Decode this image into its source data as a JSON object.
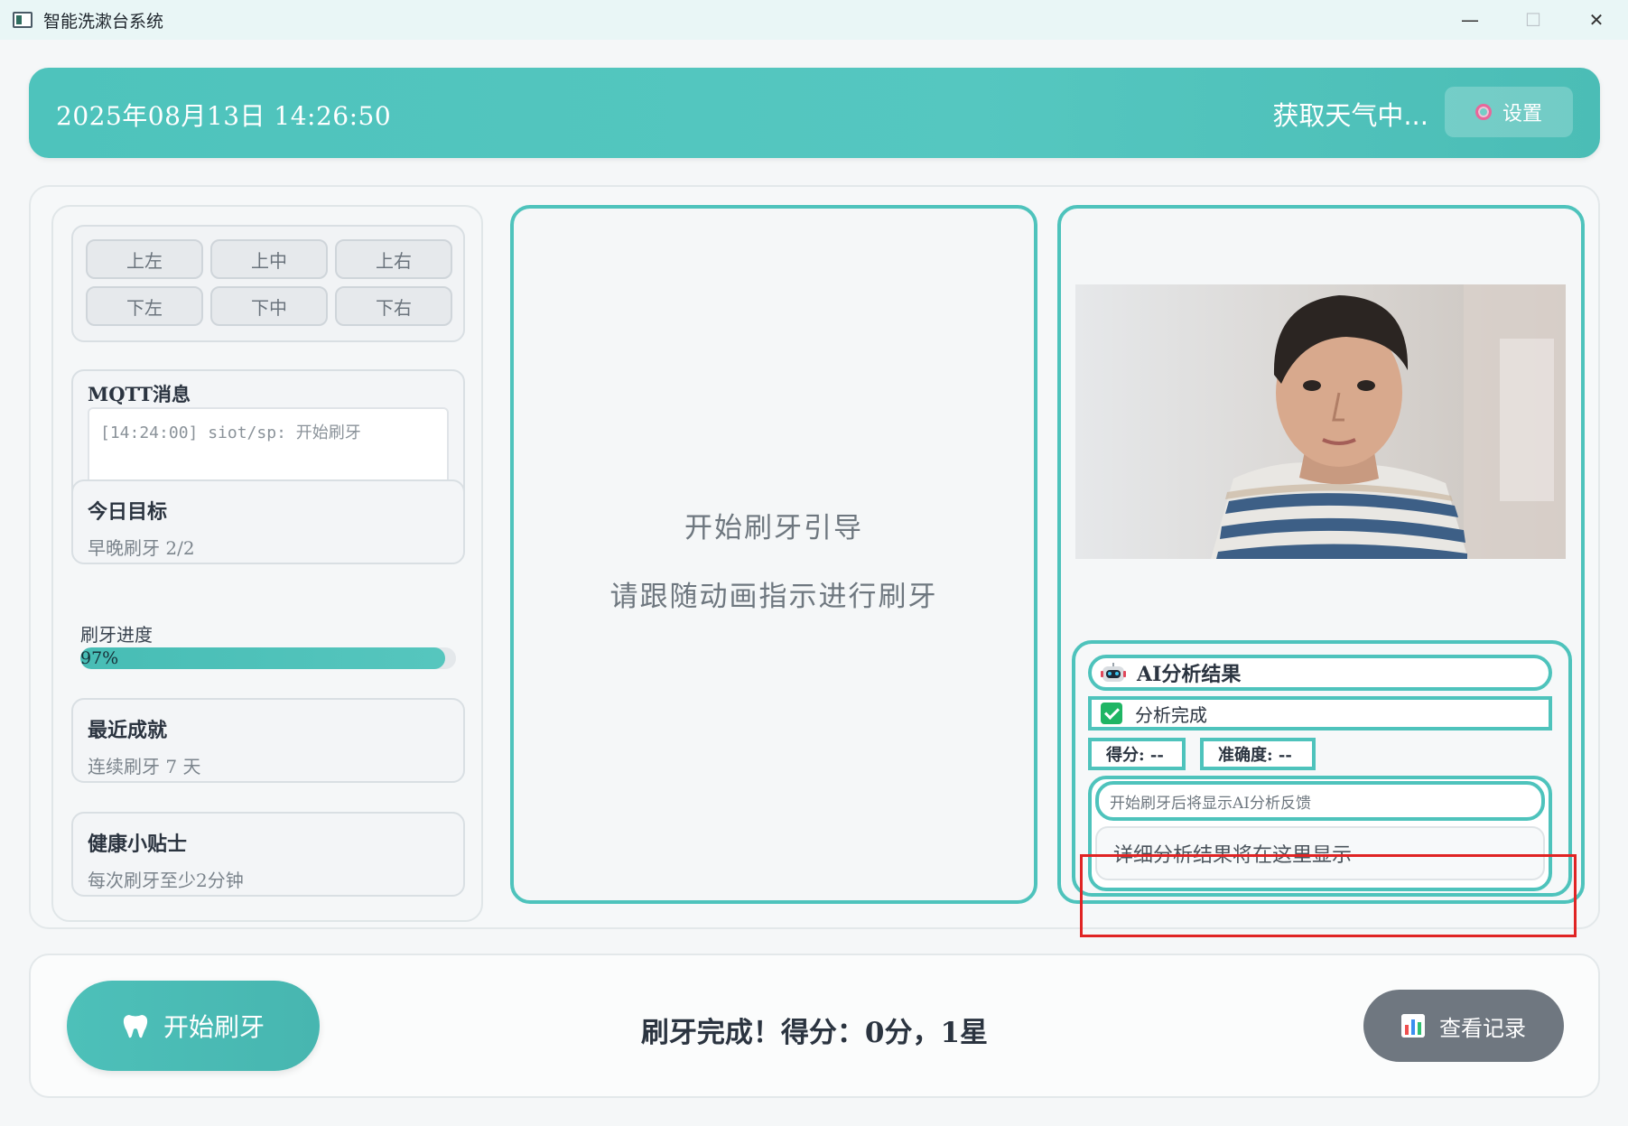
{
  "window": {
    "title": "智能洗漱台系统",
    "minimize": "—",
    "maximize": "☐",
    "close": "✕"
  },
  "header": {
    "datetime": "2025年08月13日 14:26:50",
    "weather": "获取天气中...",
    "settings_label": "设置",
    "settings_icon": "gear-icon"
  },
  "directions": {
    "top_left": "上左",
    "top_mid": "上中",
    "top_right": "上右",
    "bottom_left": "下左",
    "bottom_mid": "下中",
    "bottom_right": "下右"
  },
  "mqtt": {
    "title": "MQTT消息",
    "log": "[14:24:00] siot/sp: 开始刷牙"
  },
  "goal": {
    "title": "今日目标",
    "text": "早晚刷牙 2/2"
  },
  "progress": {
    "label": "刷牙进度",
    "value": 0.97,
    "text": "97%"
  },
  "achievement": {
    "title": "最近成就",
    "text": "连续刷牙 7 天"
  },
  "tip": {
    "title": "健康小贴士",
    "text": "每次刷牙至少2分钟"
  },
  "guide": {
    "title": "开始刷牙引导",
    "subtitle": "请跟随动画指示进行刷牙"
  },
  "ai": {
    "header": "AI分析结果",
    "header_icon": "robot-icon",
    "status": "分析完成",
    "status_icon": "check-icon",
    "score": "得分: --",
    "accuracy": "准确度: --",
    "feedback": "开始刷牙后将显示AI分析反馈",
    "detail": "详细分析结果将在这里显示"
  },
  "bottom": {
    "start_label": "开始刷牙",
    "start_icon": "tooth-icon",
    "result": "刷牙完成！得分：0分，1星",
    "records_label": "查看记录",
    "records_icon": "bar-chart-icon"
  },
  "colors": {
    "accent": "#4ec3bc",
    "highlight": "#e02424",
    "records_button": "#6f7780"
  }
}
